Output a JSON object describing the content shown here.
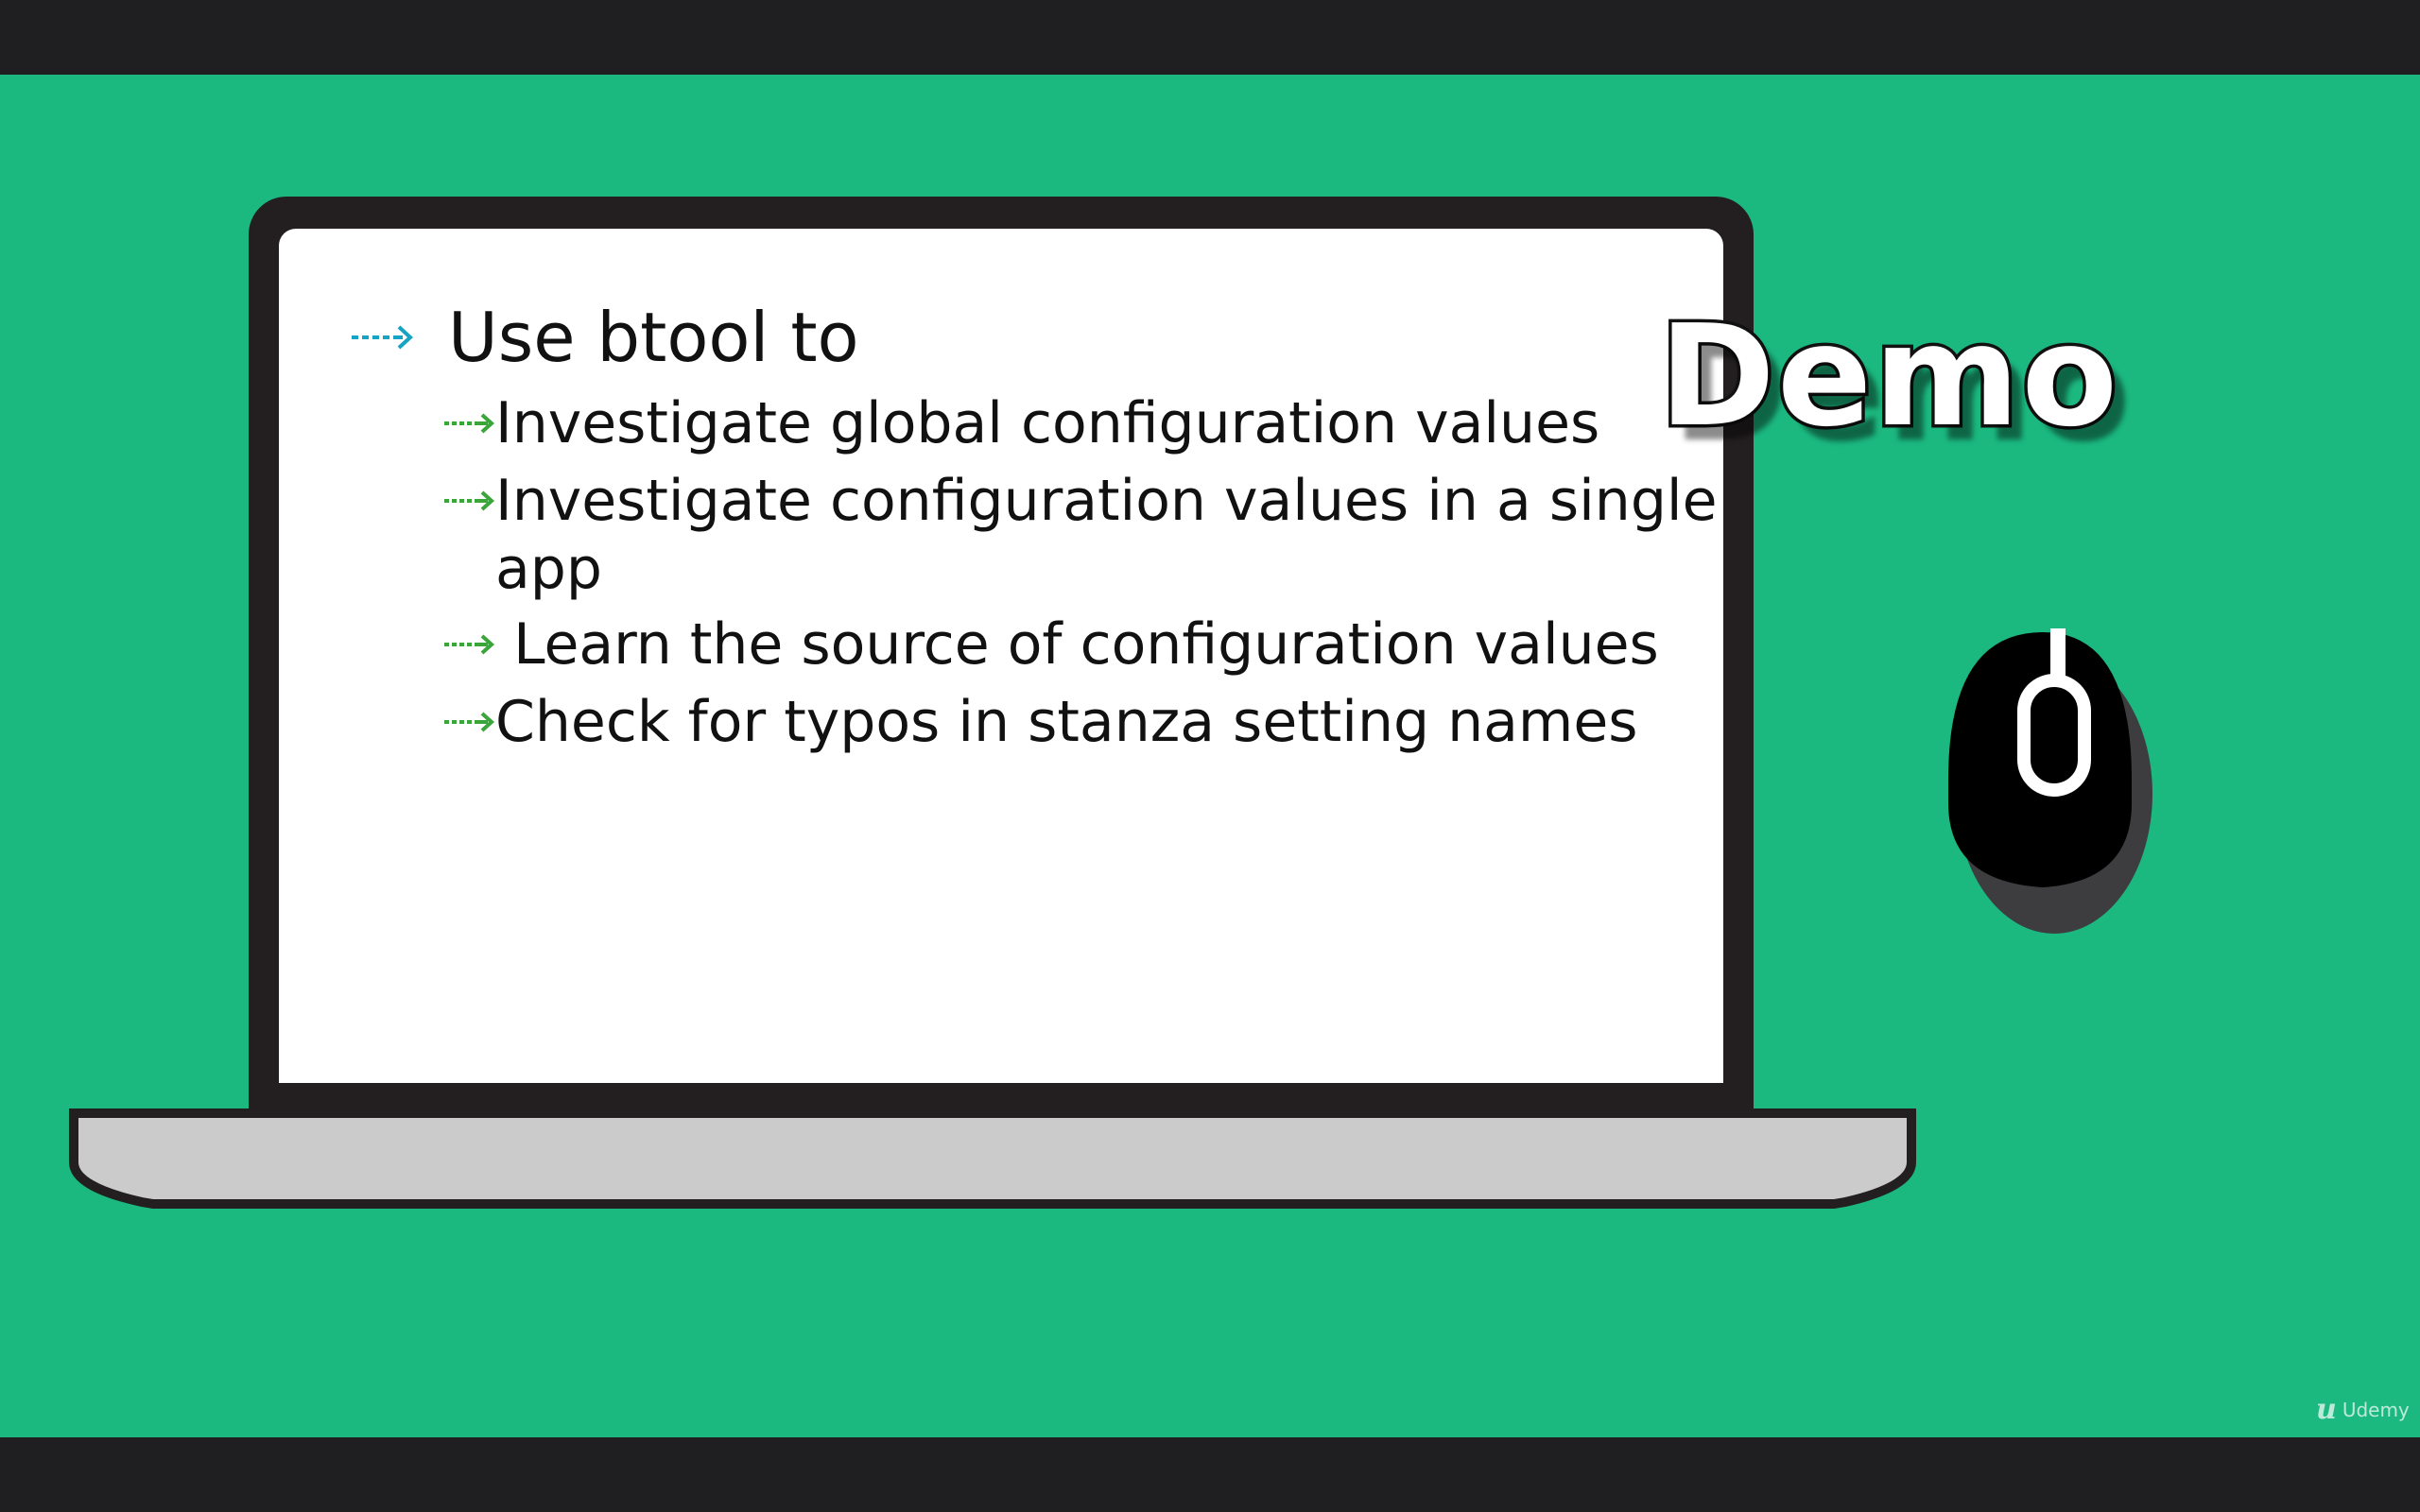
{
  "slide": {
    "main_bullet": "Use btool to",
    "sub_bullets": [
      "Investigate global configuration values",
      "Investigate configuration values in a single app",
      " Learn the source of configuration values",
      "Check for typos in stanza setting names"
    ],
    "demo_label": "Demo"
  },
  "watermark": {
    "logo": "u",
    "brand": "Udemy"
  },
  "colors": {
    "background": "#1bb980",
    "letterbox": "#1f1f21",
    "main_arrow": "#16a3c4",
    "sub_arrow": "#3aa63a"
  },
  "icons": {
    "main_bullet": "dotted-arrow-icon",
    "sub_bullet": "dotted-arrow-icon",
    "device": "laptop-icon",
    "pointer": "mouse-icon"
  }
}
